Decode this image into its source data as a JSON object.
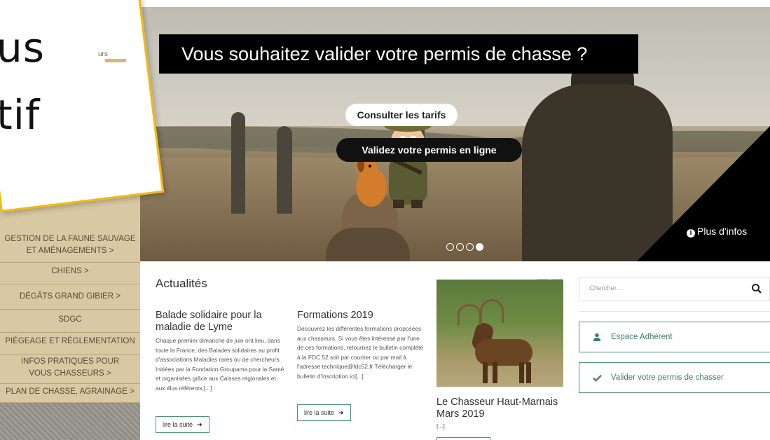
{
  "note": {
    "line1": "us",
    "line2": "tif"
  },
  "logo": {
    "fragment": "urs"
  },
  "hero": {
    "banner": "Vous souhaitez valider votre permis de chasse ?",
    "btn_tarifs": "Consulter les tarifs",
    "btn_valider": "Validez votre permis en ligne",
    "plus_infos": "Plus d'infos",
    "slides_total": 4,
    "slide_active": 4
  },
  "sidebar": {
    "items": [
      "GESTION DE LA FAUNE SAUVAGE ET AMÉNAGEMENTS >",
      "CHIENS >",
      "DÉGÂTS GRAND GIBIER >",
      "SDGC",
      "PIÉGEAGE ET RÉGLEMENTATION",
      "INFOS PRATIQUES POUR VOUS CHASSEURS >",
      "PLAN DE CHASSE, AGRAINAGE >"
    ]
  },
  "news": {
    "heading": "Actualités",
    "articles": [
      {
        "title": "Balade solidaire pour la maladie de Lyme",
        "text": "Chaque premier dimanche de juin ont lieu, dans toute la France, des Balades solidaires au profit d'associations Maladies rares ou de chercheurs. Initiées par la Fondation Groupama pour la Santé et organisées grâce aux Caisses régionales et aux élus référents,[...]",
        "readmore": "lire la suite"
      },
      {
        "title": "Formations 2019",
        "text": "Découvrez les différentes formations proposées aux chasseurs. Si vous êtes intéressé par l'une de ces formations, retournez le bulletin complété à la FDC 52 soit par courrier ou par mail à l'adresse technique@fdc52.fr  Télécharger le bulletin d'inscription ici[...]",
        "readmore": "lire la suite"
      },
      {
        "title": "Le Chasseur Haut-Marnais Mars 2019",
        "text": "[...]"
      }
    ]
  },
  "search": {
    "placeholder": "Chercher..."
  },
  "side_buttons": {
    "adherent": "Espace Adhérent",
    "valider": "Valider votre permis de chasser"
  },
  "colors": {
    "accent": "#4f8f7c",
    "note_border": "#f2b90e",
    "sidebar_bg": "#d8c8a4"
  }
}
